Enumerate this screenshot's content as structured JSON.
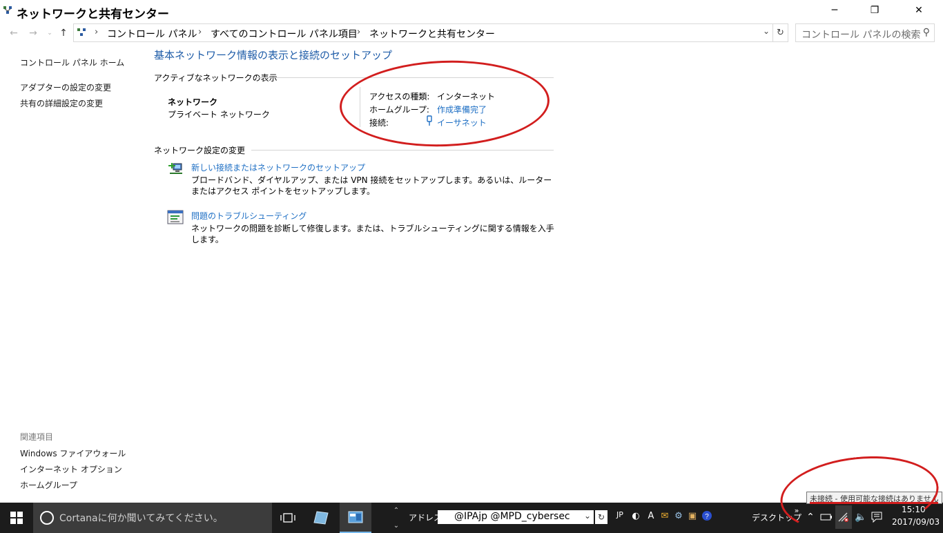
{
  "window": {
    "title": "ネットワークと共有センター",
    "minimize_icon": "minimize-icon",
    "restore_icon": "restore-icon",
    "close_icon": "close-icon"
  },
  "navigation": {
    "breadcrumb": [
      "コントロール パネル",
      "すべてのコントロール パネル項目",
      "ネットワークと共有センター"
    ],
    "search_placeholder": "コントロール パネルの検索"
  },
  "left_pane": {
    "links": [
      "コントロール パネル ホーム",
      "アダプターの設定の変更",
      "共有の詳細設定の変更"
    ],
    "related_heading": "関連項目",
    "related_links": [
      "Windows ファイアウォール",
      "インターネット オプション",
      "ホームグループ"
    ]
  },
  "main": {
    "heading": "基本ネットワーク情報の表示と接続のセットアップ",
    "active_networks_heading": "アクティブなネットワークの表示",
    "network": {
      "name": "ネットワーク",
      "type": "プライベート ネットワーク",
      "access_type_label": "アクセスの種類:",
      "access_type_value": "インターネット",
      "homegroup_label": "ホームグループ:",
      "homegroup_value": "作成準備完了",
      "connection_label": "接続:",
      "connection_value": "イーサネット"
    },
    "change_settings_heading": "ネットワーク設定の変更",
    "tasks": [
      {
        "title": "新しい接続またはネットワークのセットアップ",
        "description": "ブロードバンド、ダイヤルアップ、または VPN 接続をセットアップします。あるいは、ルーターまたはアクセス ポイントをセットアップします。"
      },
      {
        "title": "問題のトラブルシューティング",
        "description": "ネットワークの問題を診断して修復します。または、トラブルシューティングに関する情報を入手します。"
      }
    ]
  },
  "taskbar": {
    "cortana_placeholder": "Cortanaに何か聞いてみてください。",
    "address_label": "アドレス",
    "address_value": "@IPAjp @MPD_cybersec",
    "ime": "JP",
    "desktop_label": "デスクトップ",
    "time": "15:10",
    "date": "2017/09/03",
    "tooltip": "未接続 - 使用可能な接続はありません"
  },
  "colors": {
    "link": "#1e6fc4",
    "heading": "#1e5ca8",
    "annotation_red": "#d21e1e",
    "taskbar": "#1c1c1c"
  }
}
